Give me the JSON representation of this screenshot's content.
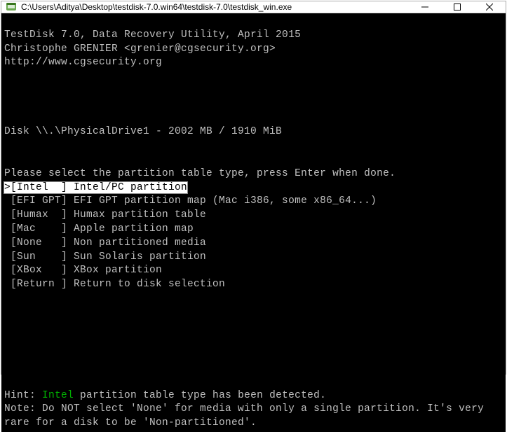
{
  "window": {
    "title": "C:\\Users\\Aditya\\Desktop\\testdisk-7.0.win64\\testdisk-7.0\\testdisk_win.exe"
  },
  "header": {
    "line1": "TestDisk 7.0, Data Recovery Utility, April 2015",
    "line2": "Christophe GRENIER <grenier@cgsecurity.org>",
    "line3": "http://www.cgsecurity.org"
  },
  "disk": "Disk \\\\.\\PhysicalDrive1 - 2002 MB / 1910 MiB",
  "prompt": "Please select the partition table type, press Enter when done.",
  "options": [
    {
      "tag": ">[Intel  ]",
      "desc": " Intel/PC partition",
      "selected": true
    },
    {
      "tag": " [EFI GPT]",
      "desc": " EFI GPT partition map (Mac i386, some x86_64...)",
      "selected": false
    },
    {
      "tag": " [Humax  ]",
      "desc": " Humax partition table",
      "selected": false
    },
    {
      "tag": " [Mac    ]",
      "desc": " Apple partition map",
      "selected": false
    },
    {
      "tag": " [None   ]",
      "desc": " Non partitioned media",
      "selected": false
    },
    {
      "tag": " [Sun    ]",
      "desc": " Sun Solaris partition",
      "selected": false
    },
    {
      "tag": " [XBox   ]",
      "desc": " XBox partition",
      "selected": false
    },
    {
      "tag": " [Return ]",
      "desc": " Return to disk selection",
      "selected": false
    }
  ],
  "hint": {
    "prefix": "Hint: ",
    "detected": "Intel",
    "suffix": " partition table type has been detected."
  },
  "note": "Note: Do NOT select 'None' for media with only a single partition. It's very\nrare for a disk to be 'Non-partitioned'."
}
